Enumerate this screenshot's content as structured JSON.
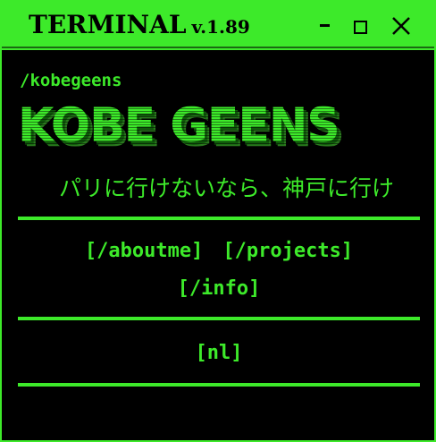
{
  "window": {
    "title": "TERMINAL",
    "version": "v.1.89",
    "controls": {
      "minimize_icon": "minimize-icon",
      "maximize_icon": "maximize-icon",
      "close_icon": "close-icon",
      "close_glyph": "✕"
    }
  },
  "content": {
    "path": "/kobegeens",
    "logo_text": "KOBE GEENS",
    "marquee": "パリに行けないなら、神戸に行け"
  },
  "nav": {
    "aboutme": "[/aboutme]",
    "projects": "[/projects]",
    "info": "[/info]",
    "language": "[nl]"
  },
  "colors": {
    "accent": "#3dea2a",
    "background": "#000000",
    "titlebar_text": "#000000"
  }
}
